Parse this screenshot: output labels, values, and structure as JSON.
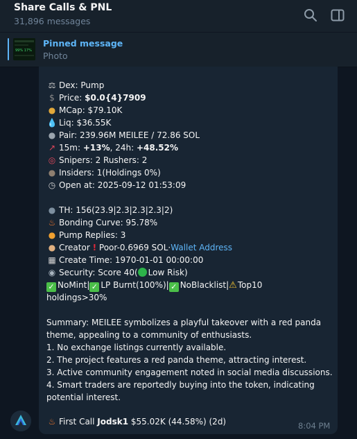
{
  "header": {
    "title": "Share Calls & PNL",
    "subtitle": "31,896 messages",
    "search_icon": "search-icon",
    "sidebar_icon": "sidebar-toggle-icon"
  },
  "pinned": {
    "title": "Pinned message",
    "subtitle": "Photo",
    "thumb_text": "99% 17%"
  },
  "message": {
    "dex_prefix": "Dex: ",
    "dex": "Pump",
    "price_label": "Price: ",
    "price": "$0.0{4}7909",
    "mcap": "MCap: $79.10K",
    "liq": "Liq: $36.55K",
    "pair": "Pair: 239.96M MEILEE / 72.86 SOL",
    "change_15m_label": "15m: ",
    "change_15m": "+13%",
    "change_24h_label": ", 24h: ",
    "change_24h": "+48.52%",
    "snipers": "Snipers: 2  Rushers: 2",
    "insiders": "Insiders: 1(Holdings 0%)",
    "open_at": "Open at: 2025-09-12 01:53:09",
    "th": "TH: 156(23.9|2.3|2.3|2.3|2)",
    "bonding_curve": "Bonding Curve: 95.78%",
    "pump_replies": "Pump Replies: 3",
    "creator_label": "Creator ",
    "creator_value": " Poor-0.6969 SOL·",
    "wallet_link": "Wallet Address",
    "create_time": "Create Time: 1970-01-01 00:00:00",
    "security_label": "Security: Score 40(",
    "security_risk": "Low Risk)",
    "nomint": "NoMint",
    "lp_burnt": "LP Burnt(100%)",
    "noblacklist": "NoBlacklist",
    "top10_a": "Top10",
    "top10_b": "holdings>30%",
    "summary_lines": [
      "Summary: MEILEE symbolizes a playful takeover with a red panda",
      "theme, appealing to a community of enthusiasts.",
      "1. No exchange listings currently available.",
      "2. The project features a red panda theme, attracting interest.",
      "3. Active community engagement noted in social media discussions.",
      "4. Smart traders are reportedly buying into the token, indicating",
      "potential interest."
    ],
    "first_call_label": "First Call ",
    "first_call_user": "Jodsk1",
    "first_call_value": " $55.02K (44.58%) (2d)",
    "time": "8:04 PM"
  },
  "colors": {
    "background": "#0e1621",
    "header": "#17212b",
    "bubble": "#182533",
    "accent": "#5eb5f7",
    "muted": "#708499"
  }
}
